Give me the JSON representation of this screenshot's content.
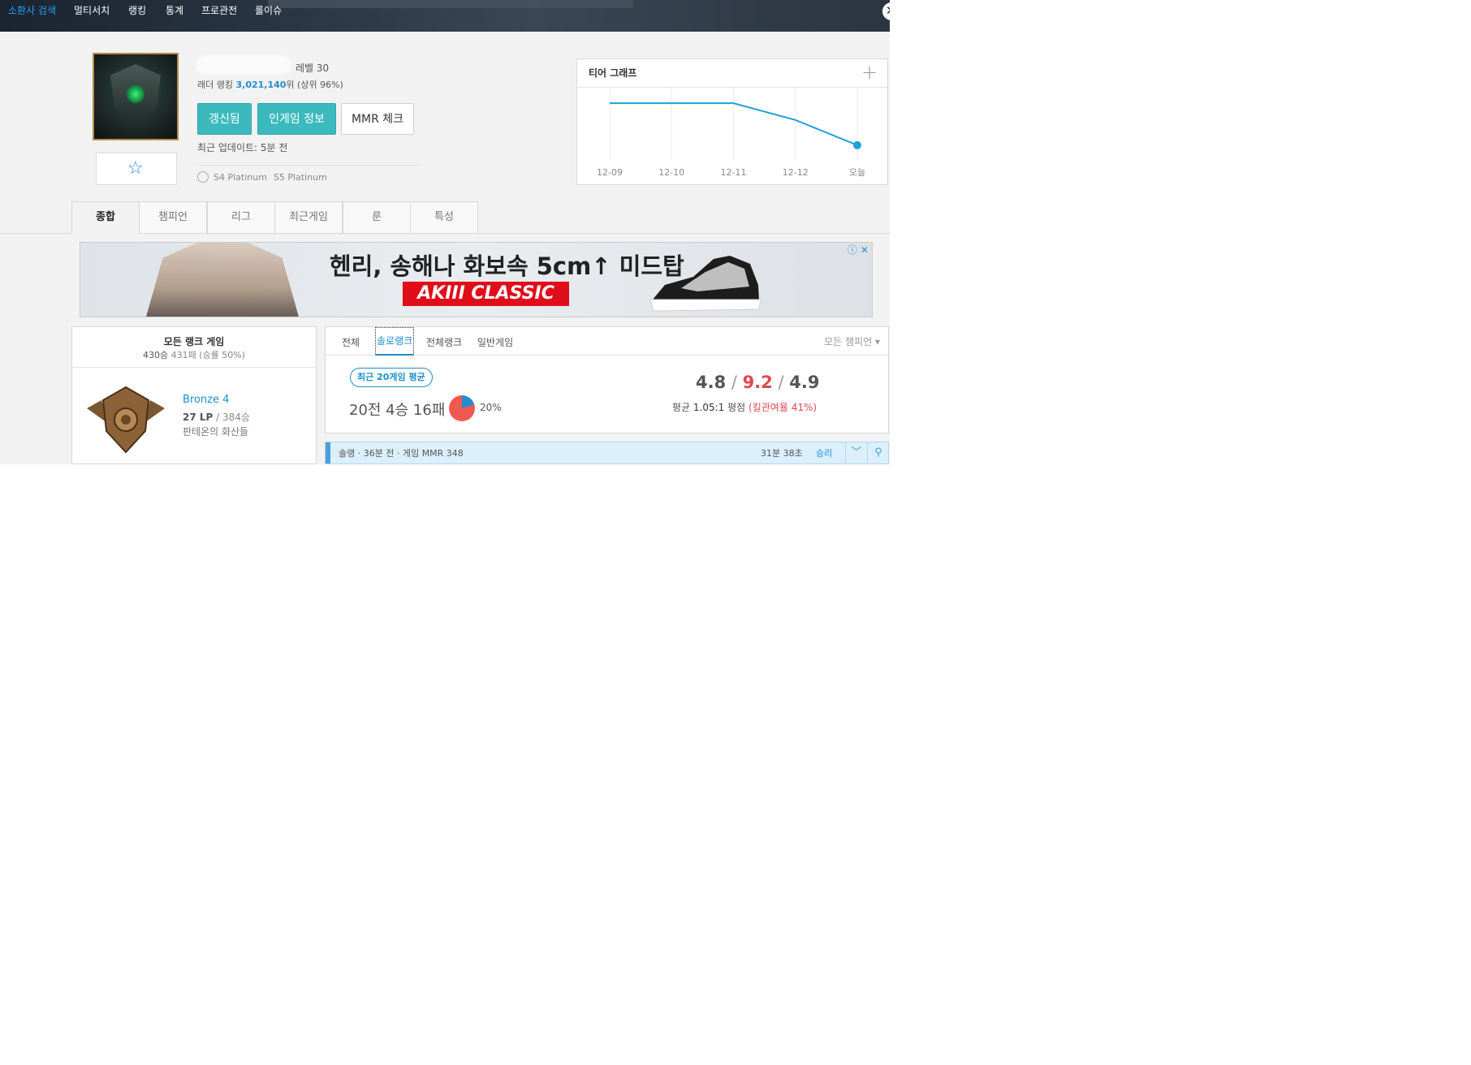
{
  "nav": {
    "items": [
      "소환사 검색",
      "멀티서치",
      "랭킹",
      "통계",
      "프로관전",
      "롤이슈"
    ]
  },
  "profile": {
    "level": "레벨 30",
    "ladder_prefix": "래더 랭킹 ",
    "ladder_rank": "3,021,140",
    "ladder_suffix": "위 (상위 96%)",
    "refresh_label": "갱신됨",
    "ingame_label": "인게임 정보",
    "mmr_label": "MMR 체크",
    "updated": "최근 업데이트: 5분 전",
    "past_tiers": [
      "S4 Platinum",
      "S5 Platinum"
    ]
  },
  "tier_graph": {
    "title": "티어 그래프",
    "plus": "+"
  },
  "chart_data": {
    "type": "line",
    "categories": [
      "12-09",
      "12-10",
      "12-11",
      "12-12",
      "오늘"
    ],
    "values": [
      0,
      0,
      0,
      -0.4,
      -1.0
    ],
    "ylim": [
      -1.1,
      0.1
    ],
    "grid": true
  },
  "tabs": [
    "종합",
    "챔피언",
    "리그",
    "최근게임",
    "룬",
    "특성"
  ],
  "ad": {
    "headline": "헨리, 송해나 화보속 5cm↑ 미드탑",
    "logo": "AKIII CLASSIC",
    "adchoice": "ⓘ ✕",
    "colors": {
      "logo_bg": "#e00d1b"
    }
  },
  "rank_panel": {
    "title": "모든 랭크 게임",
    "wins": "430승 ",
    "losses_rate": "431패 (승률 50%)",
    "tier": "Bronze 4",
    "lp": "27 LP",
    "lp_wins": " / 384승",
    "league": "판테온의 화산들"
  },
  "games": {
    "tabs": [
      "전체",
      "솔로랭크",
      "전체랭크",
      "일반게임"
    ],
    "champion_filter": "모든 챔피언 ▾",
    "recent_badge": "최근 20게임 평균",
    "record": "20전 4승 16패",
    "winrate_label": "20%",
    "winrate": 0.2,
    "kills": "4.8",
    "deaths": "9.2",
    "assists": "4.9",
    "kda_prefix": "평균 ",
    "kda_ratio": "1.05:1",
    "kda_mid": " 평점 ",
    "kill_participation": "(킬관여율 41%)"
  },
  "game_row": {
    "info": "솔랭 · 36분 전 · 게임 MMR 348",
    "duration": "31분 38초",
    "result": "승리",
    "expand_icon": "﹀",
    "search_icon": "⚲"
  },
  "colors": {
    "accent": "#1f8ecd",
    "teal": "#3cb9bd",
    "loss": "#e0484e"
  }
}
